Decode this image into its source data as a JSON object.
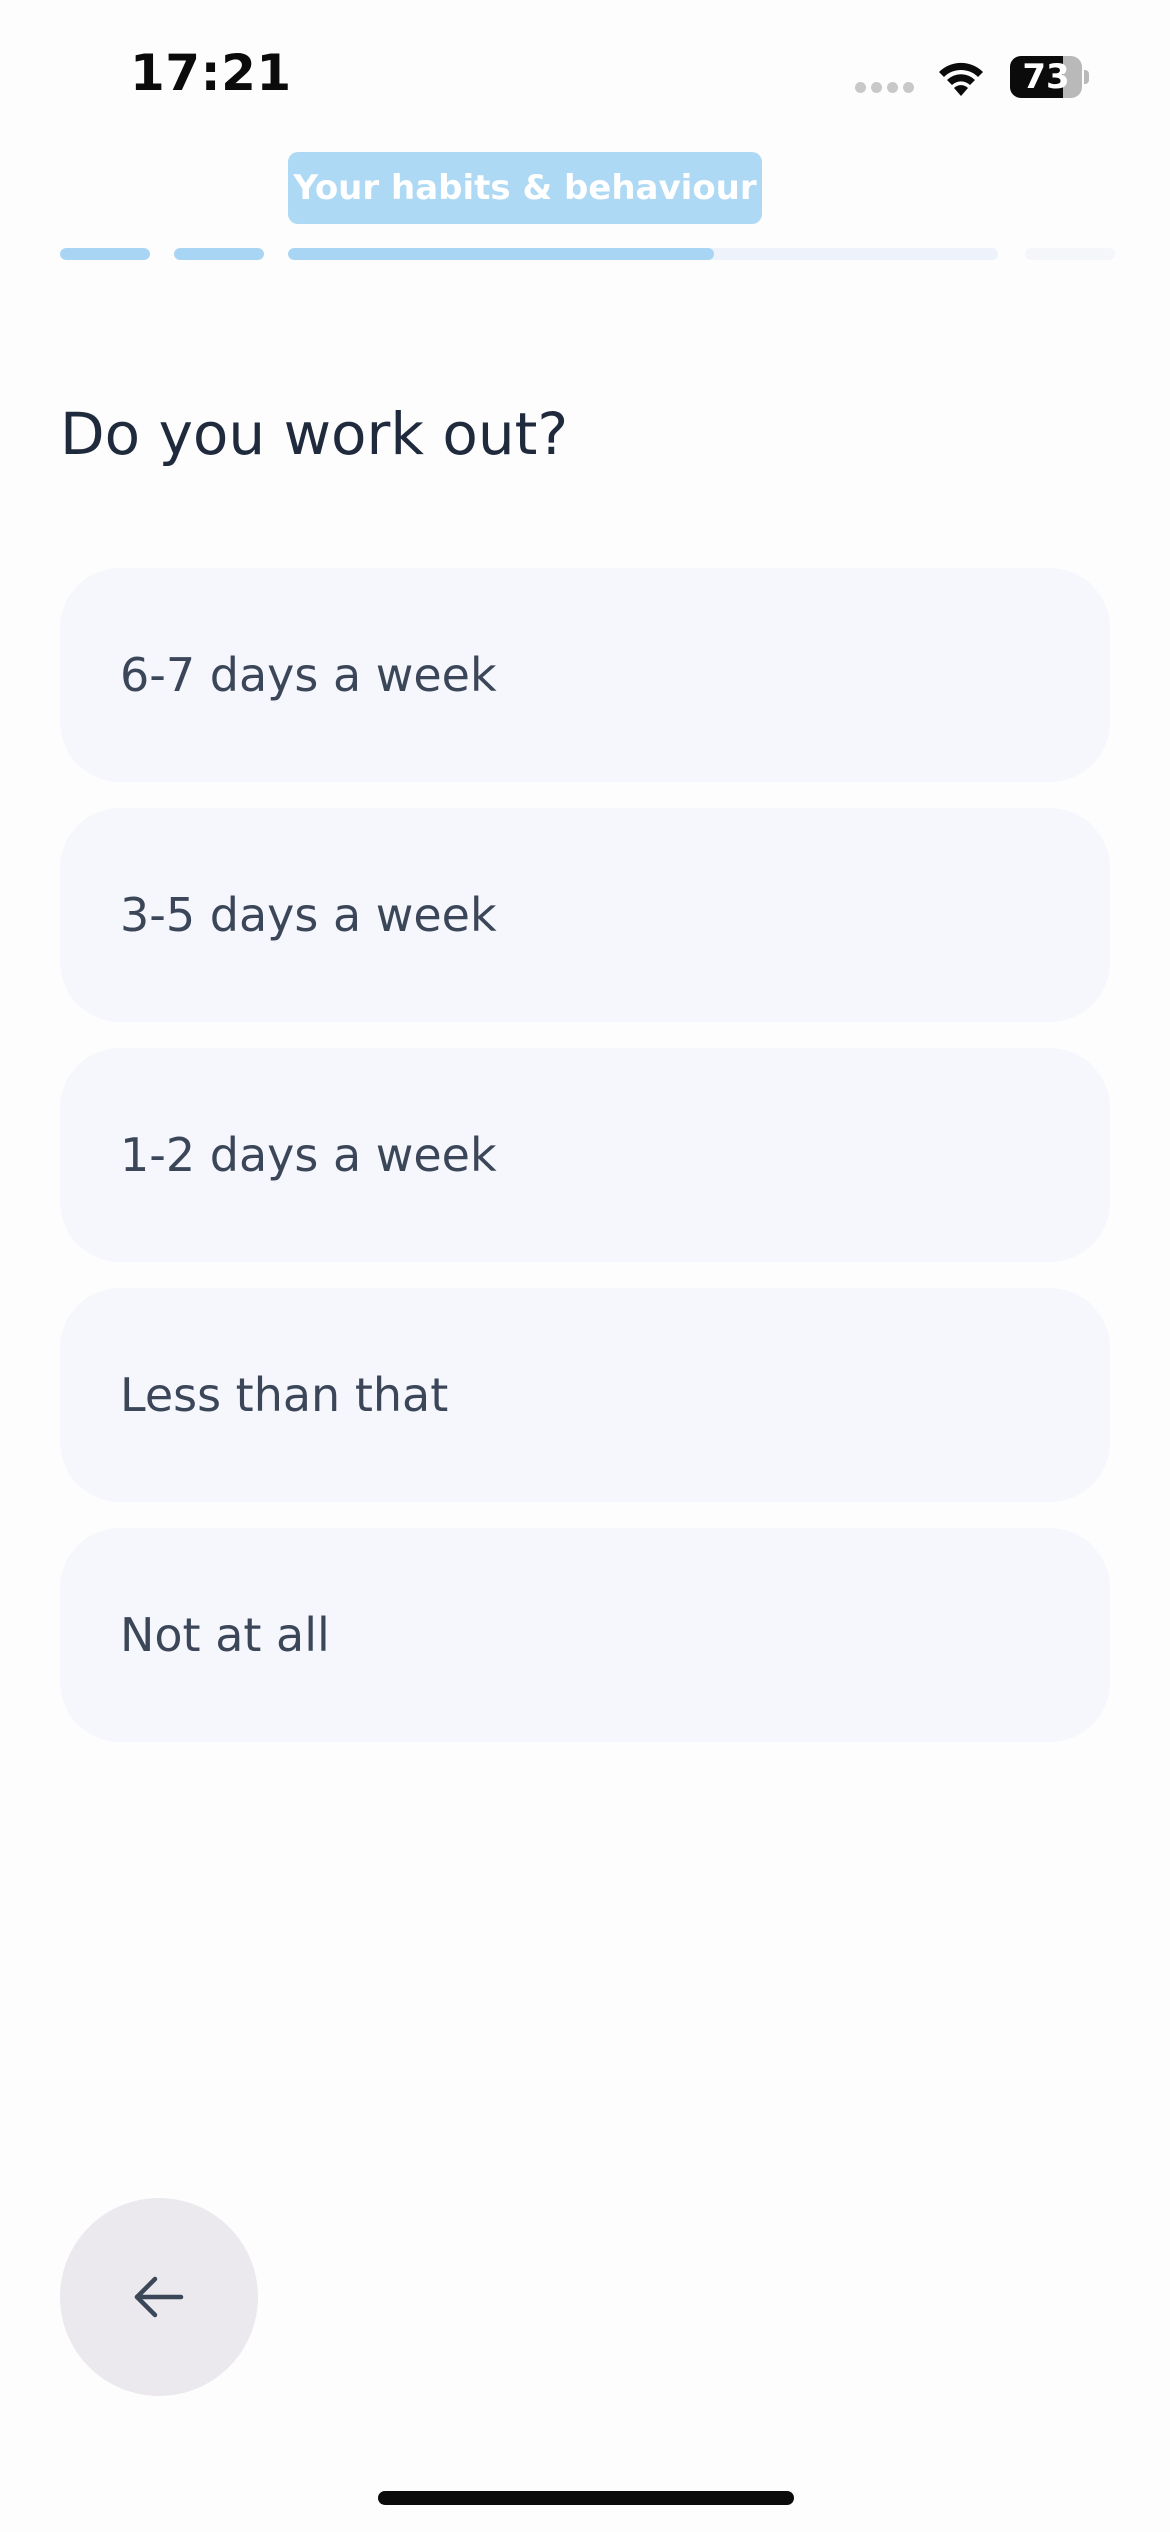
{
  "status_bar": {
    "time": "17:21",
    "battery_level": "73",
    "battery_fraction": 0.73,
    "wifi_icon": "wifi-icon"
  },
  "header": {
    "section_label": "Your habits & behaviour",
    "progress": {
      "segments_completed": 2,
      "current_segment_fraction": 0.6,
      "total_segments": 4
    }
  },
  "question": {
    "title": "Do you work out?"
  },
  "options": [
    {
      "label": "6-7 days a week"
    },
    {
      "label": "3-5 days a week"
    },
    {
      "label": "1-2 days a week"
    },
    {
      "label": "Less than that"
    },
    {
      "label": "Not at all"
    }
  ],
  "footer": {
    "back_icon": "arrow-left-icon"
  },
  "colors": {
    "accent": "#a9d5f4",
    "option_bg": "#f6f7fd",
    "text_primary": "#1f2a3d",
    "back_button_bg": "#ebe9ee"
  }
}
